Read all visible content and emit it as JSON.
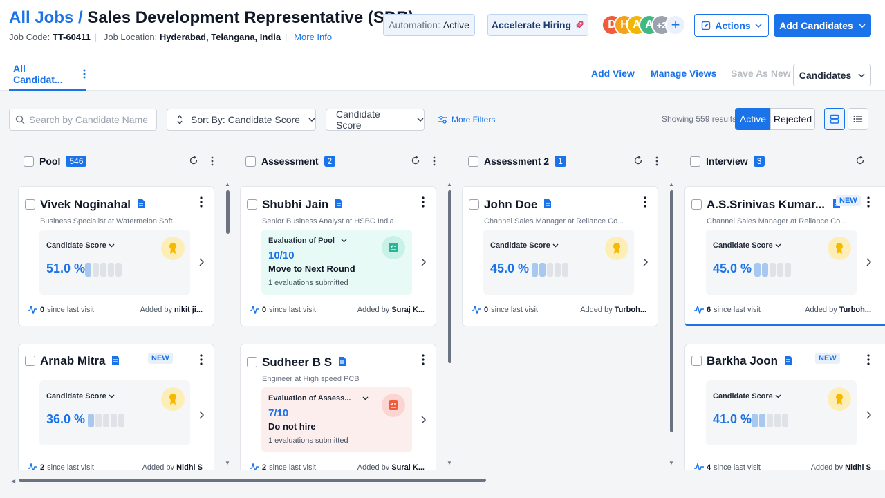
{
  "header": {
    "breadcrumb_root": "All Jobs",
    "breadcrumb_sep": "/",
    "job_title": "Sales Development Representative (SDR)",
    "job_code_label": "Job Code:",
    "job_code": "TT-60411",
    "location_label": "Job Location:",
    "location": "Hyderabad, Telangana, India",
    "more_info": "More Info",
    "automation_label": "Automation:",
    "automation_value": "Active",
    "accelerate": "Accelerate Hiring",
    "avatars": [
      {
        "letter": "D",
        "color": "#ef5b3b"
      },
      {
        "letter": "H",
        "color": "#f4a21a"
      },
      {
        "letter": "A",
        "color": "#f2b705"
      },
      {
        "letter": "A",
        "color": "#41b883"
      }
    ],
    "avatar_more": "+2",
    "add_member": "+",
    "actions": "Actions",
    "add_candidates": "Add Candidates"
  },
  "views": {
    "active_tab": "All Candidat...",
    "add_view": "Add View",
    "manage_views": "Manage Views",
    "save_as_new": "Save As New",
    "candidates_dropdown": "Candidates"
  },
  "filters": {
    "search_placeholder": "Search by Candidate Name",
    "sort_by": "Sort By: Candidate Score",
    "score_filter": "Candidate Score",
    "more_filters": "More Filters",
    "showing": "Showing 559 results",
    "active": "Active",
    "rejected": "Rejected"
  },
  "columns": [
    {
      "title": "Pool",
      "count": "546"
    },
    {
      "title": "Assessment",
      "count": "2"
    },
    {
      "title": "Assessment 2",
      "count": "1"
    },
    {
      "title": "Interview",
      "count": "3"
    }
  ],
  "cards": {
    "c1": {
      "name": "Vivek Noginahal",
      "role": "Business Specialist at Watermelon Soft...",
      "score_label": "Candidate Score",
      "score": "51.0 %",
      "score_bars": 1,
      "since_count": "0",
      "since_text": "since last visit",
      "added_label": "Added by",
      "added_by": "nikit ji..."
    },
    "c2": {
      "name": "Arnab Mitra",
      "new": "NEW",
      "score_label": "Candidate Score",
      "score": "36.0 %",
      "score_bars": 1,
      "since_count": "2",
      "since_text": "since last visit",
      "added_label": "Added by",
      "added_by": "Nidhi S"
    },
    "c3": {
      "name": "Shubhi Jain",
      "role": "Senior Business Analyst at HSBC India",
      "eval_title": "Evaluation of Pool",
      "eval_score": "10/10",
      "eval_decision": "Move to Next Round",
      "eval_note": "1 evaluations submitted",
      "since_count": "0",
      "since_text": "since last visit",
      "added_label": "Added by",
      "added_by": "Suraj K..."
    },
    "c4": {
      "name": "Sudheer B S",
      "role": "Engineer at High speed PCB",
      "eval_title": "Evaluation of Assess...",
      "eval_score": "7/10",
      "eval_decision": "Do not hire",
      "eval_note": "1 evaluations submitted",
      "since_count": "2",
      "since_text": "since last visit",
      "added_label": "Added by",
      "added_by": "Suraj K..."
    },
    "c5": {
      "name": "John Doe",
      "role": "Channel Sales Manager at Reliance Co...",
      "score_label": "Candidate Score",
      "score": "45.0 %",
      "score_bars": 2,
      "since_count": "0",
      "since_text": "since last visit",
      "added_label": "Added by",
      "added_by": "Turboh..."
    },
    "c6": {
      "name": "A.S.Srinivas Kumar...",
      "new": "NEW",
      "role": "Channel Sales Manager at Reliance Co...",
      "score_label": "Candidate Score",
      "score": "45.0 %",
      "score_bars": 2,
      "since_count": "6",
      "since_text": "since last visit",
      "added_label": "Added by",
      "added_by": "Turboh..."
    },
    "c7": {
      "name": "Barkha Joon",
      "new": "NEW",
      "score_label": "Candidate Score",
      "score": "41.0 %",
      "score_bars": 2,
      "since_count": "4",
      "since_text": "since last visit",
      "added_label": "Added by",
      "added_by": "Nidhi S"
    }
  },
  "colors": {
    "accent": "#1a73e8",
    "eval_positive": "#e8faf6",
    "eval_negative": "#fdeeee"
  }
}
